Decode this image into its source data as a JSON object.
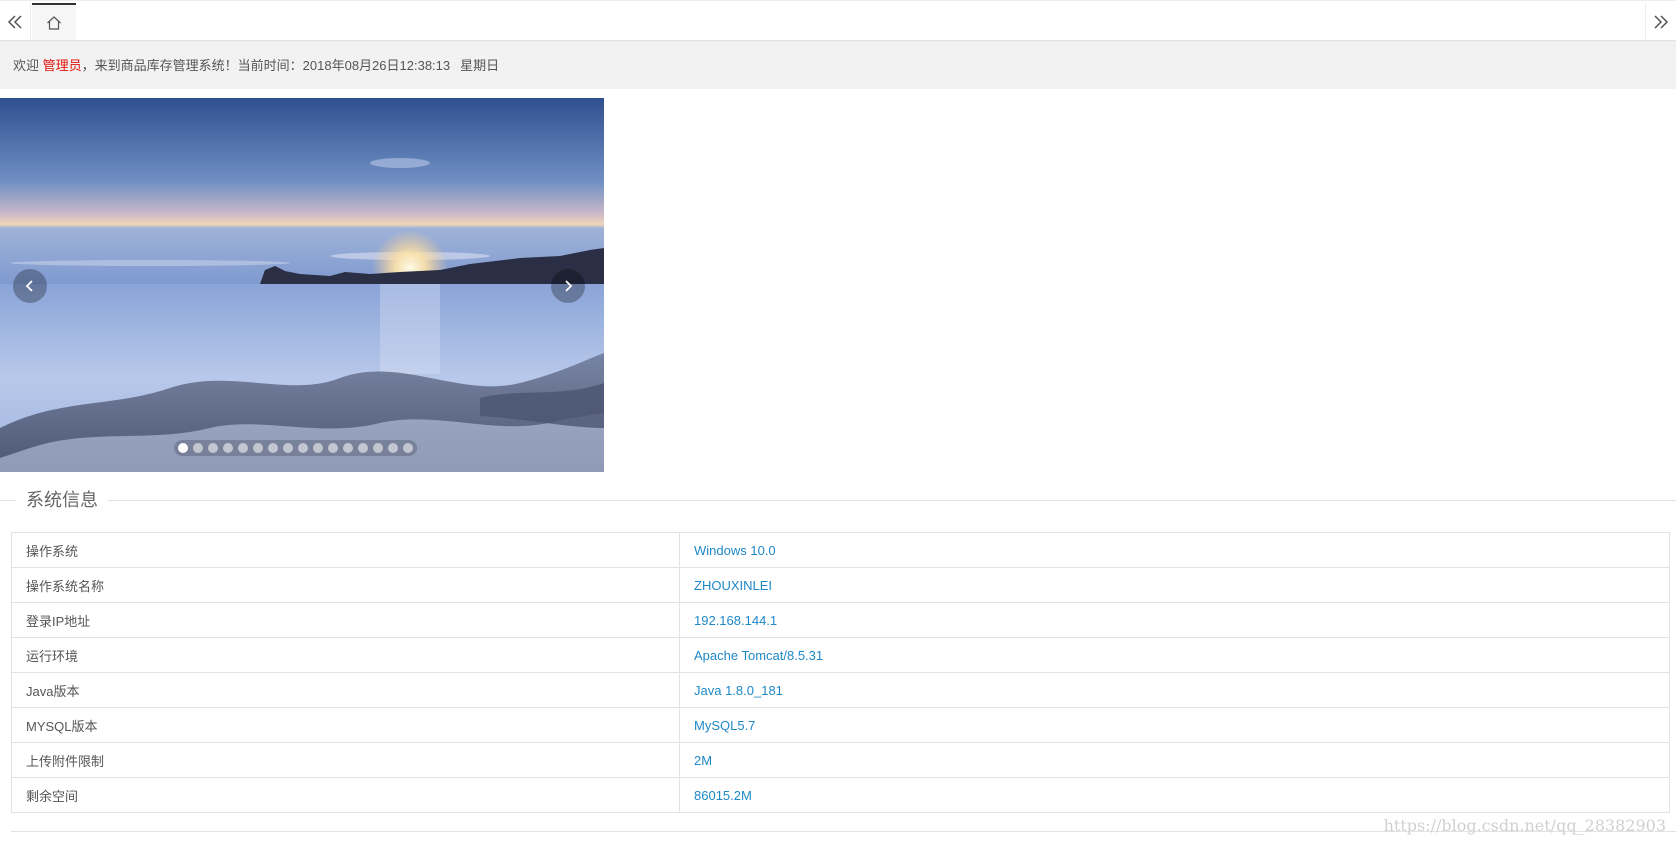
{
  "tabbar": {
    "nav_left_icon": "double-chevron-left-icon",
    "home_icon": "home-icon",
    "nav_right_icon": "double-chevron-right-icon"
  },
  "welcome": {
    "prefix": "欢迎",
    "user": "管理员",
    "middle": "，来到商品库存管理系统！当前时间：",
    "datetime": "2018年08月26日12:38:13",
    "weekday": "星期日"
  },
  "carousel": {
    "slide_count": 16,
    "active_index": 0,
    "prev_icon": "chevron-left-icon",
    "next_icon": "chevron-right-icon"
  },
  "system_info": {
    "title": "系统信息",
    "rows": [
      {
        "key": "操作系统",
        "value": "Windows 10.0"
      },
      {
        "key": "操作系统名称",
        "value": "ZHOUXINLEI"
      },
      {
        "key": "登录IP地址",
        "value": "192.168.144.1"
      },
      {
        "key": "运行环境",
        "value": "Apache Tomcat/8.5.31"
      },
      {
        "key": "Java版本",
        "value": "Java 1.8.0_181"
      },
      {
        "key": "MYSQL版本",
        "value": "MySQL5.7"
      },
      {
        "key": "上传附件限制",
        "value": "2M"
      },
      {
        "key": "剩余空间",
        "value": "86015.2M"
      }
    ]
  },
  "watermark": "https://blog.csdn.net/qq_28382903",
  "colors": {
    "accent_red": "#e0120c",
    "value_blue": "#1e88c7",
    "bar_gray": "#f2f2f2"
  }
}
